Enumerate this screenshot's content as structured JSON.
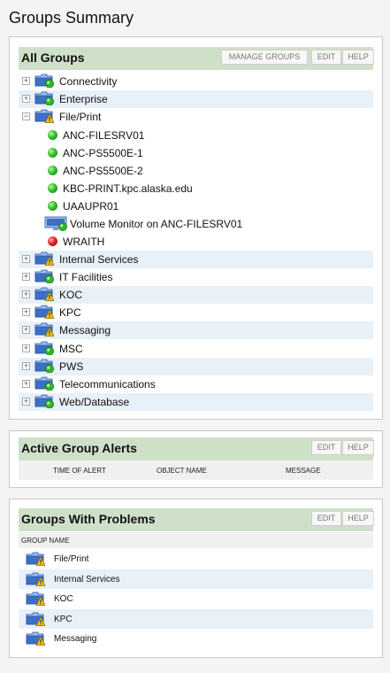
{
  "page": {
    "title": "Groups Summary"
  },
  "all_groups": {
    "title": "All Groups",
    "buttons": {
      "manage": "MANAGE GROUPS",
      "edit": "EDIT",
      "help": "HELP"
    },
    "groups": [
      {
        "label": "Connectivity",
        "status": "up"
      },
      {
        "label": "Enterprise",
        "status": "up"
      },
      {
        "label": "File/Print",
        "status": "warning",
        "expanded": true
      },
      {
        "label": "Internal Services",
        "status": "warning"
      },
      {
        "label": "IT Facilities",
        "status": "up"
      },
      {
        "label": "KOC",
        "status": "warning"
      },
      {
        "label": "KPC",
        "status": "warning"
      },
      {
        "label": "Messaging",
        "status": "warning"
      },
      {
        "label": "MSC",
        "status": "up"
      },
      {
        "label": "PWS",
        "status": "up"
      },
      {
        "label": "Telecommunications",
        "status": "up"
      },
      {
        "label": "Web/Database",
        "status": "up"
      }
    ],
    "fileprint_members": [
      {
        "label": "ANC-FILESRV01",
        "status": "up",
        "icon": "green-dot-icon"
      },
      {
        "label": "ANC-PS5500E-1",
        "status": "up",
        "icon": "green-dot-icon"
      },
      {
        "label": "ANC-PS5500E-2",
        "status": "up",
        "icon": "green-dot-icon"
      },
      {
        "label": "KBC-PRINT.kpc.alaska.edu",
        "status": "up",
        "icon": "green-dot-icon"
      },
      {
        "label": "UAAUPR01",
        "status": "up",
        "icon": "green-dot-icon"
      },
      {
        "label": "Volume Monitor on ANC-FILESRV01",
        "status": "up",
        "icon": "volume-monitor-icon"
      },
      {
        "label": "WRAITH",
        "status": "down",
        "icon": "red-dot-icon"
      }
    ]
  },
  "active_alerts": {
    "title": "Active Group Alerts",
    "buttons": {
      "edit": "EDIT",
      "help": "HELP"
    },
    "columns": [
      "TIME OF ALERT",
      "OBJECT NAME",
      "MESSAGE"
    ]
  },
  "problems": {
    "title": "Groups With Problems",
    "buttons": {
      "edit": "EDIT",
      "help": "HELP"
    },
    "column": "GROUP NAME",
    "items": [
      "File/Print",
      "Internal Services",
      "KOC",
      "KPC",
      "Messaging"
    ]
  },
  "colors": {
    "header_bg": "#cfe0c9",
    "alt_row": "#e8f0f8",
    "folder_blue": "#3d6fc4",
    "status_up": "#33c02a",
    "status_warning": "#f2c21a",
    "status_down": "#e02222"
  }
}
